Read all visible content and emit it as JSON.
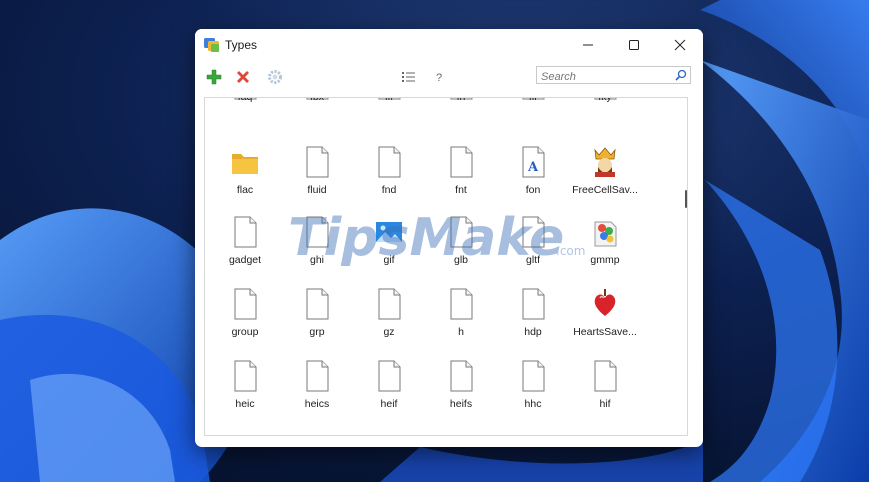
{
  "window": {
    "title": "Types"
  },
  "toolbar": {
    "help_label": "?"
  },
  "search": {
    "placeholder": "Search"
  },
  "watermark": {
    "brand": "TipsMake",
    "suffix": ".com"
  },
  "file_types": [
    {
      "label": "faq",
      "icon": "blank-file-icon"
    },
    {
      "label": "fbx",
      "icon": "blank-file-icon"
    },
    {
      "label": "fff",
      "icon": "blank-file-icon"
    },
    {
      "label": "fh",
      "icon": "blank-file-icon"
    },
    {
      "label": "fif",
      "icon": "blank-file-icon"
    },
    {
      "label": "fky",
      "icon": "blank-file-icon"
    },
    {
      "label": "flac",
      "icon": "folder-icon"
    },
    {
      "label": "fluid",
      "icon": "blank-file-icon"
    },
    {
      "label": "fnd",
      "icon": "blank-file-icon"
    },
    {
      "label": "fnt",
      "icon": "blank-file-icon"
    },
    {
      "label": "fon",
      "icon": "font-file-icon"
    },
    {
      "label": "FreeCellSav...",
      "icon": "freecell-king-icon"
    },
    {
      "label": "gadget",
      "icon": "blank-file-icon"
    },
    {
      "label": "ghi",
      "icon": "blank-file-icon"
    },
    {
      "label": "gif",
      "icon": "image-file-icon"
    },
    {
      "label": "glb",
      "icon": "blank-file-icon"
    },
    {
      "label": "gltf",
      "icon": "blank-file-icon"
    },
    {
      "label": "gmmp",
      "icon": "media-player-icon"
    },
    {
      "label": "group",
      "icon": "blank-file-icon"
    },
    {
      "label": "grp",
      "icon": "blank-file-icon"
    },
    {
      "label": "gz",
      "icon": "blank-file-icon"
    },
    {
      "label": "h",
      "icon": "blank-file-icon"
    },
    {
      "label": "hdp",
      "icon": "blank-file-icon"
    },
    {
      "label": "HeartsSave...",
      "icon": "hearts-icon"
    },
    {
      "label": "heic",
      "icon": "blank-file-icon"
    },
    {
      "label": "heics",
      "icon": "blank-file-icon"
    },
    {
      "label": "heif",
      "icon": "blank-file-icon"
    },
    {
      "label": "heifs",
      "icon": "blank-file-icon"
    },
    {
      "label": "hhc",
      "icon": "blank-file-icon"
    },
    {
      "label": "hif",
      "icon": "blank-file-icon"
    }
  ],
  "colors": {
    "wallpaper_dark": "#0a1a3e",
    "wallpaper_blue": "#1d5fd6",
    "add_green": "#3aa63a",
    "delete_red": "#e0453a",
    "folder_yellow": "#f5c542"
  }
}
